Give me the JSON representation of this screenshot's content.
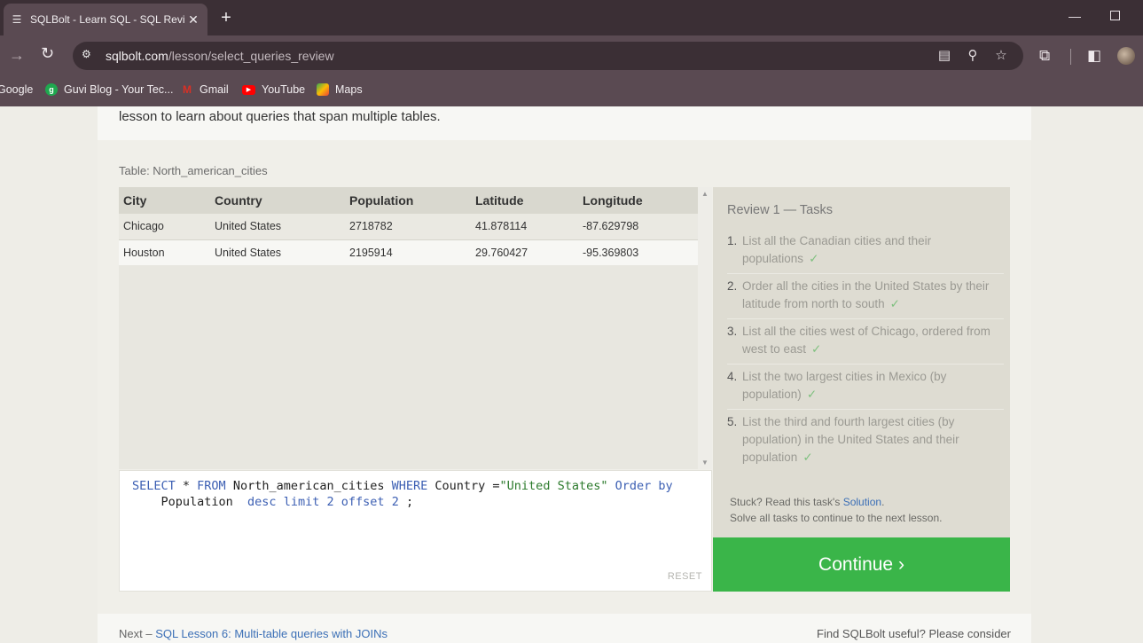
{
  "browser": {
    "tab_title": "SQLBolt - Learn SQL - SQL Revie",
    "tab_close": "✕",
    "new_tab": "+",
    "url_domain": "sqlbolt.com",
    "url_path": "/lesson/select_queries_review",
    "bookmarks": [
      {
        "label": "Google",
        "icon": "google-icon"
      },
      {
        "label": "Guvi Blog - Your Tec...",
        "icon": "guvi-icon",
        "color": "#1fa84f"
      },
      {
        "label": "Gmail",
        "icon": "gmail-icon",
        "color": "#d93025"
      },
      {
        "label": "YouTube",
        "icon": "youtube-icon",
        "color": "#ff0000"
      },
      {
        "label": "Maps",
        "icon": "maps-icon",
        "color": "#34a853"
      }
    ]
  },
  "intro_text": "lesson to learn about queries that span multiple tables.",
  "table_label": "Table: North_american_cities",
  "results": {
    "columns": [
      "City",
      "Country",
      "Population",
      "Latitude",
      "Longitude"
    ],
    "rows": [
      [
        "Chicago",
        "United States",
        "2718782",
        "41.878114",
        "-87.629798"
      ],
      [
        "Houston",
        "United States",
        "2195914",
        "29.760427",
        "-95.369803"
      ]
    ]
  },
  "editor": {
    "line1": {
      "t1": "SELECT",
      "t2": " * ",
      "t3": "FROM",
      "t4": " North_american_cities ",
      "t5": "WHERE",
      "t6": " Country =",
      "t7": "\"United States\"",
      "t8": " Order by"
    },
    "line2": {
      "t1": "    Population  ",
      "t2": "desc",
      "t3": " ",
      "t4": "limit",
      "t5": " ",
      "t6": "2",
      "t7": " ",
      "t8": "offset",
      "t9": " ",
      "t10": "2",
      "t11": " ;"
    },
    "reset_label": "RESET"
  },
  "tasks": {
    "title": "Review 1 — Tasks",
    "check": "✓",
    "items": [
      {
        "num": "1.",
        "text": "List all the Canadian cities and their populations"
      },
      {
        "num": "2.",
        "text": "Order all the cities in the United States by their latitude from north to south"
      },
      {
        "num": "3.",
        "text": "List all the cities west of Chicago, ordered from west to east"
      },
      {
        "num": "4.",
        "text": "List the two largest cities in Mexico (by population)"
      },
      {
        "num": "5.",
        "text": "List the third and fourth largest cities (by population) in the United States and their population"
      }
    ],
    "stuck_text": "Stuck? Read this task's ",
    "solution_link": "Solution",
    "stuck_end": ".",
    "solve_all": "Solve all tasks to continue to the next lesson."
  },
  "continue_label": "Continue ›",
  "footer": {
    "next_prefix": "Next – ",
    "next_link": "SQL Lesson 6: Multi-table queries with JOINs",
    "useful": "Find SQLBolt useful? Please consider"
  },
  "colors": {
    "continue": "#3ab549",
    "keyword": "#3c5fb3",
    "string": "#2b7a2b",
    "check": "#7fc07f",
    "link": "#3b6fb6"
  }
}
